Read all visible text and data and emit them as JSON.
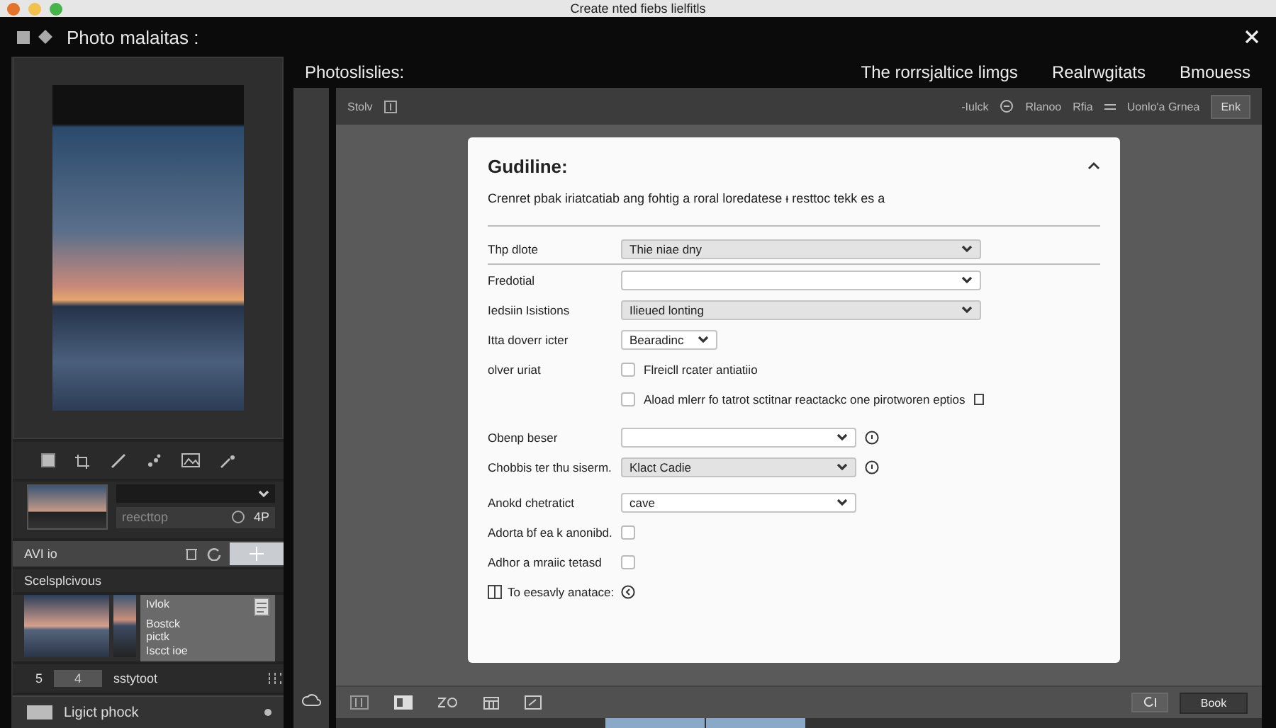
{
  "window": {
    "title": "Create nted fiebs lielfitls"
  },
  "app_bar": {
    "title": "Photo malaitas :"
  },
  "sidebar": {
    "preset_field": "reecttop",
    "preset_value": "4P",
    "file_label": "AVI io",
    "section_title": "Scelsplcivous",
    "thumb_texts": [
      "Ivlok",
      "Bostck",
      "pictk",
      "Iscct ioe"
    ],
    "number": "5",
    "count_field": "4",
    "footer_text": "sstytoot",
    "bottom_item": "Ligict phock"
  },
  "content_header": {
    "title": "Photoslislies:",
    "links": [
      "The rorrsjaltice limgs",
      "Realrwgitats",
      "Bmouess"
    ]
  },
  "toolbar": {
    "left_label": "Stolv",
    "right_items": [
      "-Iulck",
      "Rlanoo",
      "Rfia",
      "Uonlo'a Grnea"
    ],
    "button": "Enk"
  },
  "dialog": {
    "title": "Gudiline:",
    "description": "Crenret pbak iriatcatiab ang fohtig a roral loredatese ᵻ resttoc tekk es a",
    "rows": [
      {
        "kind": "select_wide",
        "label": "Thp dlote",
        "value": "Thie niae dny",
        "highlighted": true
      },
      {
        "kind": "select_wide",
        "label": "Fredotial",
        "value": "",
        "highlighted": false
      },
      {
        "kind": "select_wide",
        "label": "Iedsiin Isistions",
        "value": "Ilieued lonting",
        "highlighted": true
      },
      {
        "kind": "select_small",
        "label": "Itta doverr icter",
        "value": "Bearadinc",
        "highlighted": false
      },
      {
        "kind": "checkbox",
        "label": "olver uriat",
        "text": "Flreicll rcater antiatiio",
        "checked": false
      },
      {
        "kind": "checkbox_note",
        "label": "",
        "text": "Aload mlerr fo tatrot sctitnar reactackc one pirotworen eptios",
        "checked": false
      },
      {
        "kind": "select_help",
        "label": "Obenp beser",
        "value": "",
        "highlighted": false
      },
      {
        "kind": "select_help",
        "label": "Chobbis ter thu siserm.",
        "value": "Klact Cadie",
        "highlighted": true
      },
      {
        "kind": "select",
        "label": "Anokd chetratict",
        "value": "cave",
        "highlighted": false
      },
      {
        "kind": "checkbox",
        "label": "Adorta bf ea k anonibd.",
        "text": "",
        "checked": false
      },
      {
        "kind": "checkbox",
        "label": "Adhor a mraiic tetasd",
        "text": "",
        "checked": false
      },
      {
        "kind": "action",
        "label": "To eesavly anatace:"
      }
    ]
  },
  "bottom_bar": {
    "button": "Book"
  }
}
